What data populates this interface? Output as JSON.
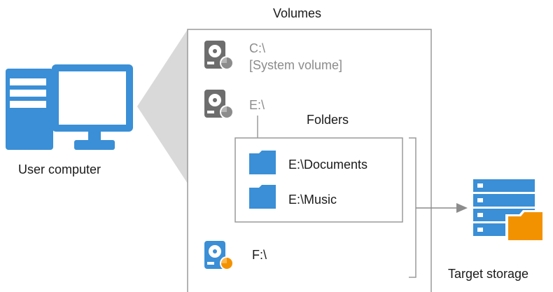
{
  "volumes_box": {
    "title": "Volumes"
  },
  "volumes": [
    {
      "label": "C:\\",
      "sublabel": "[System volume]",
      "included": false
    },
    {
      "label": "E:\\",
      "included": false
    },
    {
      "label": "F:\\",
      "included": true
    }
  ],
  "folders_box": {
    "title": "Folders",
    "items": [
      {
        "label": "E:\\Documents"
      },
      {
        "label": "E:\\Music"
      }
    ]
  },
  "source": {
    "label": "User computer",
    "icon": "computer-icon"
  },
  "target": {
    "label": "Target storage",
    "icon": "storage-icon"
  },
  "colors": {
    "blue": "#3a8fd6",
    "orange": "#f39200",
    "grey_icon": "#6d6d6d",
    "grey_text": "#8c8c8c",
    "frame": "#9a9a9a",
    "wedge": "#d9d9d9"
  }
}
